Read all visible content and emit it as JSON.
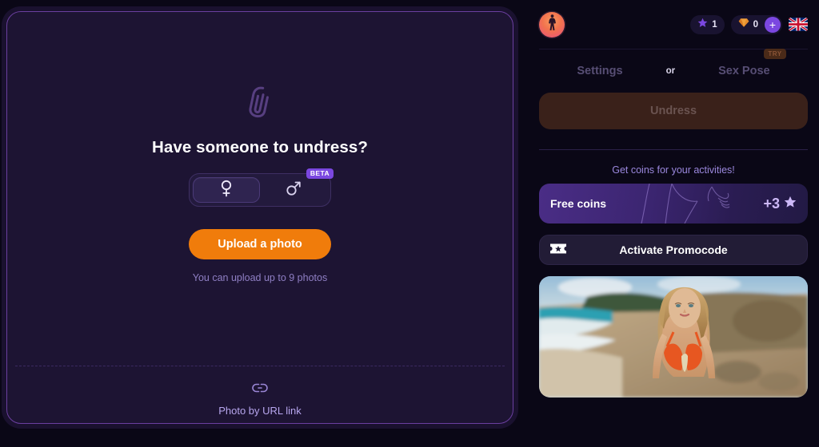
{
  "app": {
    "logo_icon": "woman-silhouette-logo"
  },
  "upload_panel": {
    "clip_icon": "paperclip-icon",
    "title": "Have someone to undress?",
    "gender": {
      "female_icon": "female-gender-icon",
      "male_icon": "male-gender-icon",
      "selected": "female",
      "beta_badge": "BETA"
    },
    "upload_button": "Upload a photo",
    "hint": "You can upload up to 9 photos",
    "url_link_icon": "link-icon",
    "url_link_label": "Photo by URL link"
  },
  "topbar": {
    "stars": {
      "icon": "star-icon",
      "value": "1"
    },
    "coins": {
      "icon": "gem-icon",
      "value": "0",
      "plus": "+"
    },
    "language": {
      "icon": "uk-flag-icon"
    }
  },
  "tabs": {
    "settings": "Settings",
    "or": "or",
    "sex_pose": "Sex Pose",
    "try_badge": "TRY"
  },
  "actions": {
    "undress": "Undress"
  },
  "coins_section": {
    "caption": "Get coins for your activities!",
    "free_coins_label": "Free coins",
    "free_coins_amount": "+3",
    "free_coins_icon": "star-icon",
    "promocode_label": "Activate Promocode",
    "promocode_icon": "ticket-icon"
  },
  "promo_image": {
    "alt": "woman-in-orange-bikini-on-beach"
  },
  "colors": {
    "accent_orange": "#f07c0b",
    "accent_purple": "#7b47e0",
    "panel_bg": "#1d1433",
    "app_bg": "#0a0716",
    "panel_border": "#6b3fa0"
  }
}
